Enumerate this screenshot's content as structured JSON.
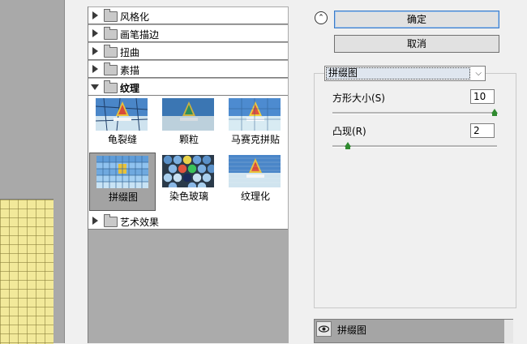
{
  "filter_tree": {
    "categories": [
      {
        "label": "风格化",
        "expanded": false
      },
      {
        "label": "画笔描边",
        "expanded": false
      },
      {
        "label": "扭曲",
        "expanded": false
      },
      {
        "label": "素描",
        "expanded": false
      },
      {
        "label": "纹理",
        "expanded": true
      },
      {
        "label": "艺术效果",
        "expanded": false
      }
    ],
    "texture_filters": [
      {
        "label": "龟裂缝",
        "selected": false
      },
      {
        "label": "颗粒",
        "selected": false
      },
      {
        "label": "马赛克拼贴",
        "selected": false
      },
      {
        "label": "拼缀图",
        "selected": true
      },
      {
        "label": "染色玻璃",
        "selected": false
      },
      {
        "label": "纹理化",
        "selected": false
      }
    ]
  },
  "buttons": {
    "ok": "确定",
    "cancel": "取消"
  },
  "filter_select": {
    "value": "拼缀图"
  },
  "params": [
    {
      "label": "方形大小(S)",
      "value": "10",
      "fraction": 1.0
    },
    {
      "label": "凸现(R)",
      "value": "2",
      "fraction": 0.08
    }
  ],
  "effect_layer": {
    "name": "拼缀图"
  },
  "icons": {
    "collapse": "double-chevron-up-icon",
    "folder": "folder-icon",
    "expand": "triangle-right-icon",
    "collapse_cat": "triangle-down-icon",
    "visibility": "eye-icon",
    "dropdown": "chevron-down-icon"
  },
  "colors": {
    "preview_tile": "#f2e99a",
    "slider_knob": "#2f8a2f",
    "selected_thumb_bg": "#a3a3a3"
  }
}
